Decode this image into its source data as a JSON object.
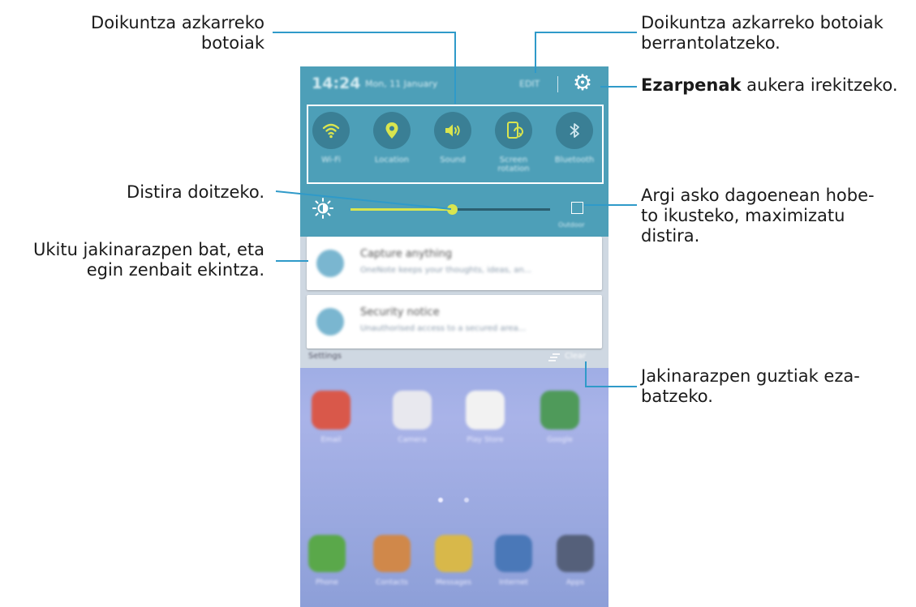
{
  "callouts": {
    "quick_buttons": "Doikuntza azkarreko\nbotoiak",
    "rearrange": "Doikuntza azkarreko botoiak\nberrantolatzeko.",
    "settings_bold": "Ezarpenak",
    "settings_rest": " aukera irekitzeko.",
    "brightness": "Distira doitzeko.",
    "outdoor": "Argi asko dagoenean hobe-\nto ikusteko, maximizatu\ndistira.",
    "notification": "Ukitu jakinarazpen bat, eta\negin zenbait ekintza.",
    "clear_all": "Jakinarazpen guztiak eza-\nbatzeko."
  },
  "phone": {
    "status_time": "14:24",
    "status_date": "Mon, 11 January",
    "edit_label": "EDIT",
    "quick_settings": [
      {
        "icon": "wifi-icon",
        "label": "Wi-Fi"
      },
      {
        "icon": "location-icon",
        "label": "Location"
      },
      {
        "icon": "sound-icon",
        "label": "Sound"
      },
      {
        "icon": "screen-rotation-icon",
        "label": "Screen rotation"
      },
      {
        "icon": "bluetooth-icon",
        "label": "Bluetooth"
      }
    ],
    "brightness": {
      "level": 0.51,
      "outdoor_label": "Outdoor"
    },
    "notifications": [
      {
        "title": "Capture anything",
        "text": "OneNote keeps your thoughts, ideas, an..."
      },
      {
        "title": "Security notice",
        "text": "Unauthorised access to a secured area..."
      }
    ],
    "notif_settings": "Settings",
    "clear_label": "Clear",
    "home_apps": [
      "Email",
      "Camera",
      "Play Store",
      "Google"
    ],
    "dock_apps": [
      "Phone",
      "Contacts",
      "Messages",
      "Internet",
      "Apps"
    ]
  },
  "colors": {
    "panel": "#4d9fb8",
    "accent": "#d9e54f",
    "button_bg": "#3a7f95"
  }
}
